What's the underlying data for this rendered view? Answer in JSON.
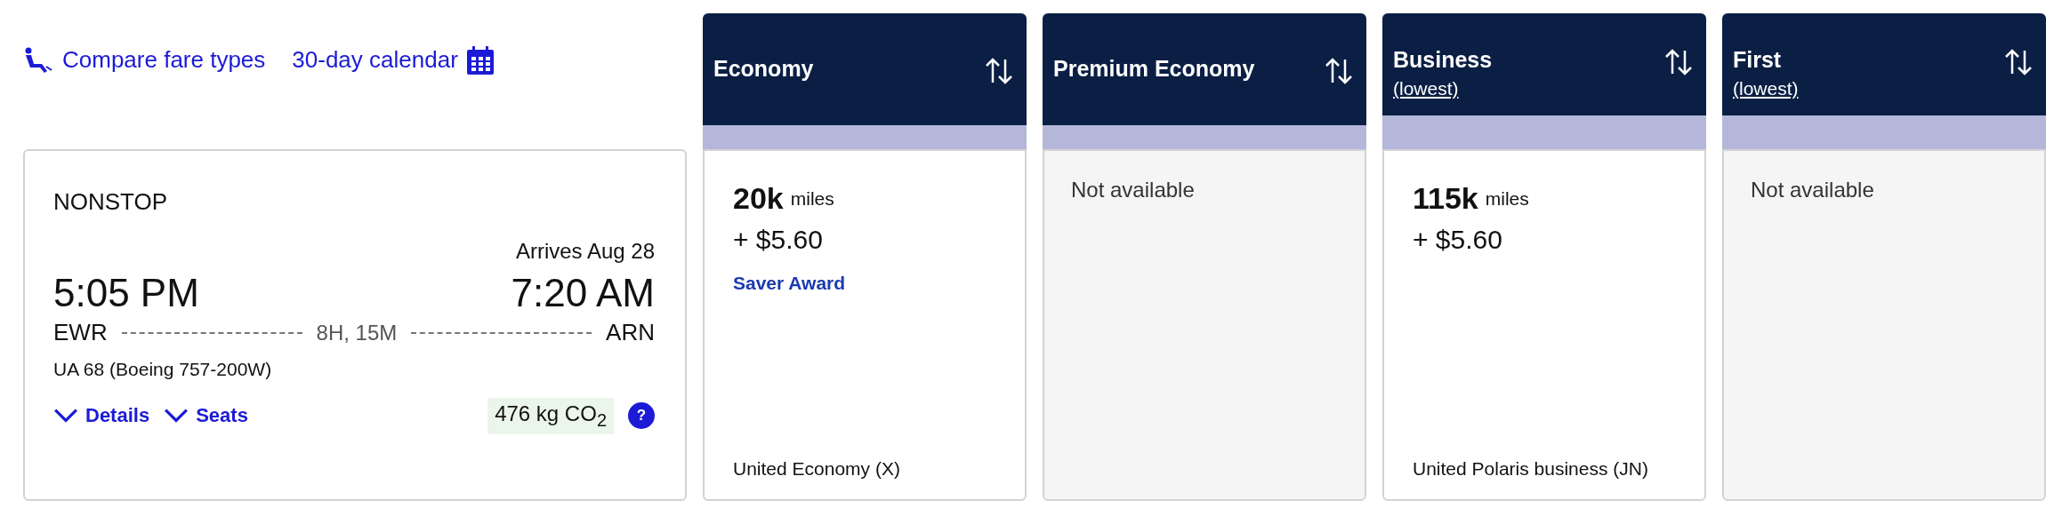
{
  "links": [
    {
      "kind": "seat",
      "label": "Compare fare types"
    },
    {
      "kind": "calendar",
      "label": "30-day calendar"
    }
  ],
  "flight": {
    "stops": "NONSTOP",
    "arrival_note": "Arrives Aug 28",
    "depart_time": "5:05 PM",
    "arrive_time": "7:20 AM",
    "origin": "EWR",
    "destination": "ARN",
    "duration": "8H, 15M",
    "aircraft": "UA 68 (Boeing 757-200W)",
    "toggles": [
      {
        "label": "Details",
        "expanded": false
      },
      {
        "label": "Seats",
        "expanded": false
      }
    ],
    "emissions": "476 kg CO$_{2}$",
    "help": "?"
  },
  "fares": [
    {
      "title": "Economy",
      "kind": "fare",
      "miles": "20k",
      "unit": "miles",
      "price": "+ $5.60",
      "award": "Saver Award",
      "cabin": "United Economy (X)"
    },
    {
      "title": "Premium Economy",
      "kind": "unavailable",
      "note": "Not available"
    },
    {
      "title": "Business",
      "subtitle": "(lowest)",
      "kind": "fare",
      "miles": "115k",
      "unit": "miles",
      "price": "+ $5.60",
      "cabin": "United Polaris business (JN)"
    },
    {
      "title": "First",
      "subtitle": "(lowest)",
      "kind": "unavailable",
      "note": "Not available"
    }
  ]
}
